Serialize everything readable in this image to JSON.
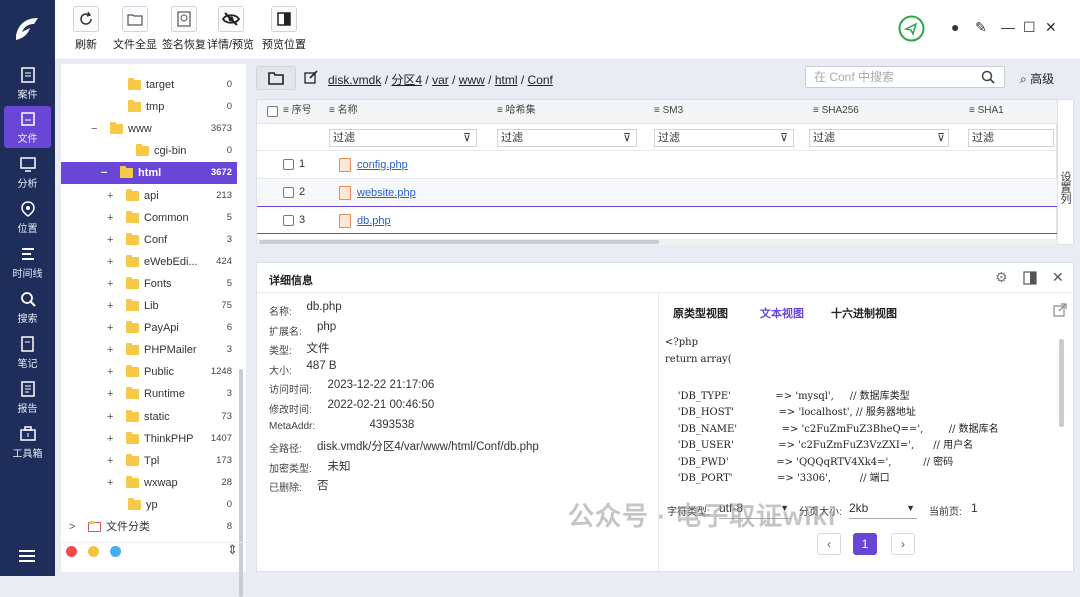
{
  "toolbar": {
    "buttons": [
      "刷新",
      "文件全显",
      "签名恢复",
      "详情/预览",
      "预览位置"
    ]
  },
  "nav": {
    "items": [
      "案件",
      "文件",
      "分析",
      "位置",
      "时间线",
      "搜索",
      "笔记",
      "报告",
      "工具箱"
    ],
    "active": "文件"
  },
  "tree": {
    "rows": [
      {
        "label": "target",
        "count": "0",
        "expander": ""
      },
      {
        "label": "tmp",
        "count": "0",
        "expander": ""
      },
      {
        "label": "www",
        "count": "3673",
        "expander": "−"
      },
      {
        "label": "cgi-bin",
        "count": "0",
        "expander": ""
      },
      {
        "label": "html",
        "count": "3672",
        "expander": "−"
      },
      {
        "label": "api",
        "count": "213",
        "expander": "+"
      },
      {
        "label": "Common",
        "count": "5",
        "expander": "+"
      },
      {
        "label": "Conf",
        "count": "3",
        "expander": "+"
      },
      {
        "label": "eWebEdi...",
        "count": "424",
        "expander": "+"
      },
      {
        "label": "Fonts",
        "count": "5",
        "expander": "+"
      },
      {
        "label": "Lib",
        "count": "75",
        "expander": "+"
      },
      {
        "label": "PayApi",
        "count": "6",
        "expander": "+"
      },
      {
        "label": "PHPMailer",
        "count": "3",
        "expander": "+"
      },
      {
        "label": "Public",
        "count": "1248",
        "expander": "+"
      },
      {
        "label": "Runtime",
        "count": "3",
        "expander": "+"
      },
      {
        "label": "static",
        "count": "73",
        "expander": "+"
      },
      {
        "label": "ThinkPHP",
        "count": "1407",
        "expander": "+"
      },
      {
        "label": "Tpl",
        "count": "173",
        "expander": "+"
      },
      {
        "label": "wxwap",
        "count": "28",
        "expander": "+"
      },
      {
        "label": "yp",
        "count": "0",
        "expander": ""
      },
      {
        "label": "文件分类",
        "count": "8",
        "expander": ">"
      }
    ],
    "selected": "html"
  },
  "path": {
    "segments": [
      "disk.vmdk",
      "分区4",
      "var",
      "www",
      "html",
      "Conf"
    ],
    "search_placeholder": "在 Conf 中搜索",
    "advanced": "高级"
  },
  "grid": {
    "columns": [
      "序号",
      "名称",
      "哈希集",
      "SM3",
      "SHA256",
      "SHA1"
    ],
    "filter_label": "过滤",
    "rows": [
      {
        "index": "1",
        "name": "config.php"
      },
      {
        "index": "2",
        "name": "website.php"
      },
      {
        "index": "3",
        "name": "db.php"
      }
    ],
    "set_columns": "设置列"
  },
  "detail": {
    "title": "详细信息",
    "fields": [
      {
        "label": "名称:",
        "value": "db.php"
      },
      {
        "label": "扩展名:",
        "value": "php"
      },
      {
        "label": "类型:",
        "value": "文件"
      },
      {
        "label": "大小:",
        "value": "487 B"
      },
      {
        "label": "访问时间:",
        "value": "2023-12-22 21:17:06"
      },
      {
        "label": "修改时间:",
        "value": "2022-02-21 00:46:50"
      },
      {
        "label": "MetaAddr:",
        "value": "4393538"
      },
      {
        "label": "全路径:",
        "value": "disk.vmdk/分区4/var/www/html/Conf/db.php"
      },
      {
        "label": "加密类型:",
        "value": "未知"
      },
      {
        "label": "已删除:",
        "value": "否"
      }
    ],
    "tabs": [
      "原类型视图",
      "文本视图",
      "十六进制视图"
    ],
    "active_tab": "文本视图",
    "code_lines": [
      "<?php",
      "return array(",
      "",
      "    'DB_TYPE'              => 'mysql',     // 数据库类型",
      "    'DB_HOST'              => 'localhost', // 服务器地址",
      "    'DB_NAME'              => 'c2FuZmFuZ3BheQ==',        // 数据库名",
      "    'DB_USER'              => 'c2FuZmFuZ3VzZXI=',      // 用户名",
      "    'DB_PWD'               => 'QQQqRTV4Xk4=',          // 密码",
      "    'DB_PORT'              => '3306',         // 端口"
    ],
    "charset_label": "字符类型:",
    "charset_value": "utf-8",
    "pagesize_label": "分页大小:",
    "pagesize_value": "2kb",
    "curpage_label": "当前页:",
    "curpage_value": "1",
    "page_number": "1"
  },
  "watermark": "公众号 · 电子取证wiki",
  "colors": {
    "nav": "#1f2d5a",
    "accent": "#6a46d6",
    "link": "#2a62c9"
  }
}
